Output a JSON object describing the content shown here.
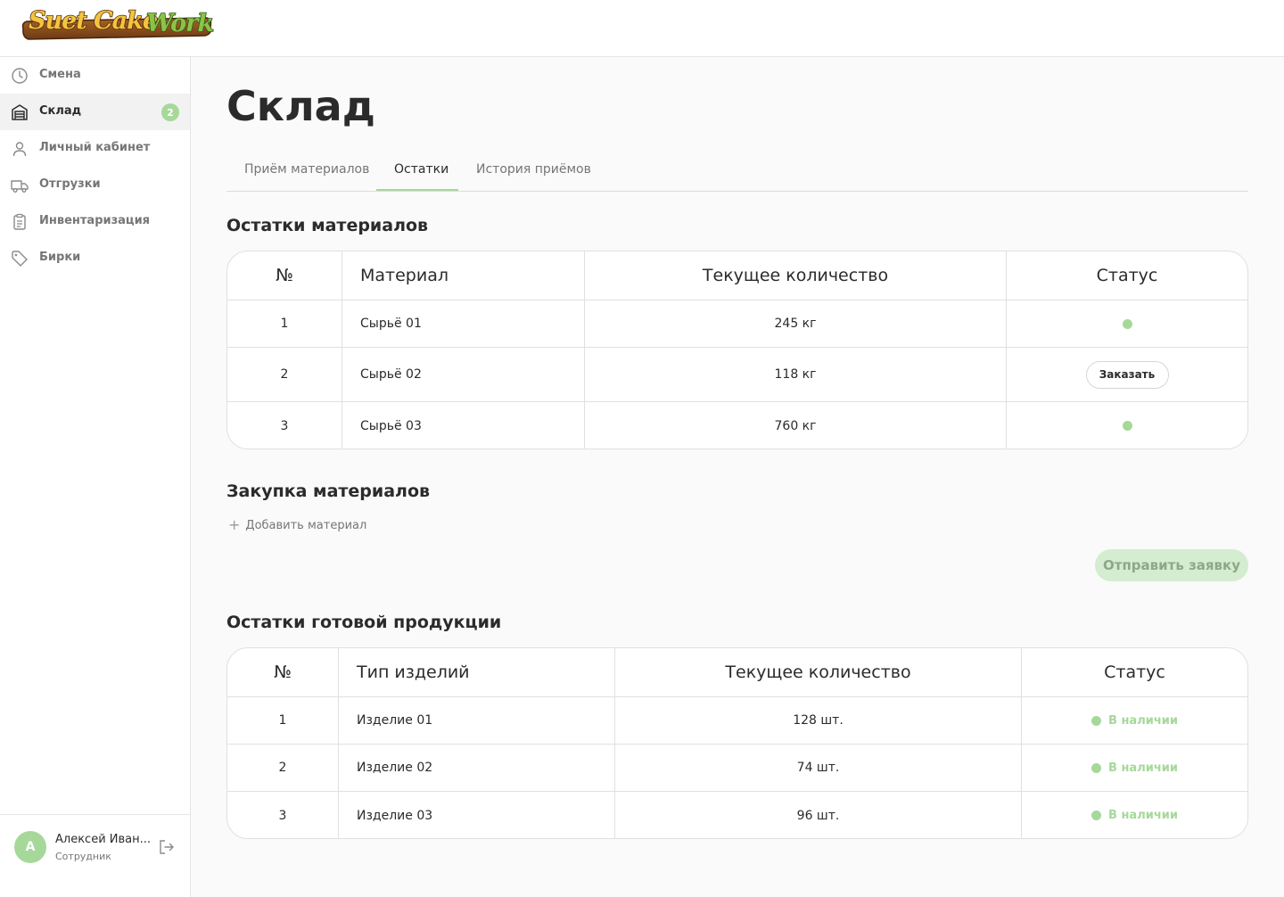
{
  "logo": {
    "text": "SuetCakeWork"
  },
  "sidebar": {
    "items": [
      {
        "label": "Смена",
        "icon": "clock-icon"
      },
      {
        "label": "Склад",
        "icon": "warehouse-icon",
        "badge": "2",
        "active": true
      },
      {
        "label": "Личный кабинет",
        "icon": "user-icon"
      },
      {
        "label": "Отгрузки",
        "icon": "truck-icon"
      },
      {
        "label": "Инвентаризация",
        "icon": "clipboard-icon"
      },
      {
        "label": "Бирки",
        "icon": "tag-icon"
      }
    ],
    "user": {
      "initial": "А",
      "name": "Алексей Иван...",
      "role": "Сотрудник"
    }
  },
  "page": {
    "title": "Склад"
  },
  "tabs": [
    {
      "label": "Приём материалов"
    },
    {
      "label": "Остатки",
      "active": true
    },
    {
      "label": "История приёмов"
    }
  ],
  "materials": {
    "title": "Остатки материалов",
    "headers": [
      "№",
      "Материал",
      "Текущее количество",
      "Статус"
    ],
    "rows": [
      {
        "num": "1",
        "name": "Сырьё 01",
        "qty": "245 кг",
        "status": "dot"
      },
      {
        "num": "2",
        "name": "Сырьё 02",
        "qty": "118 кг",
        "status": "button",
        "button_label": "Заказать"
      },
      {
        "num": "3",
        "name": "Сырьё 03",
        "qty": "760 кг",
        "status": "dot"
      }
    ]
  },
  "purchase": {
    "title": "Закупка материалов",
    "add_label": "Добавить материал",
    "send_label": "Отправить заявку"
  },
  "products": {
    "title": "Остатки готовой продукции",
    "headers": [
      "№",
      "Тип изделий",
      "Текущее количество",
      "Статус"
    ],
    "rows": [
      {
        "num": "1",
        "name": "Изделие 01",
        "qty": "128 шт.",
        "status": "В наличии"
      },
      {
        "num": "2",
        "name": "Изделие 02",
        "qty": "74 шт.",
        "status": "В наличии"
      },
      {
        "num": "3",
        "name": "Изделие 03",
        "qty": "96 шт.",
        "status": "В наличии"
      }
    ]
  },
  "colors": {
    "accent": "#a6d89a",
    "text": "#2b2b2b",
    "muted": "#767676"
  }
}
